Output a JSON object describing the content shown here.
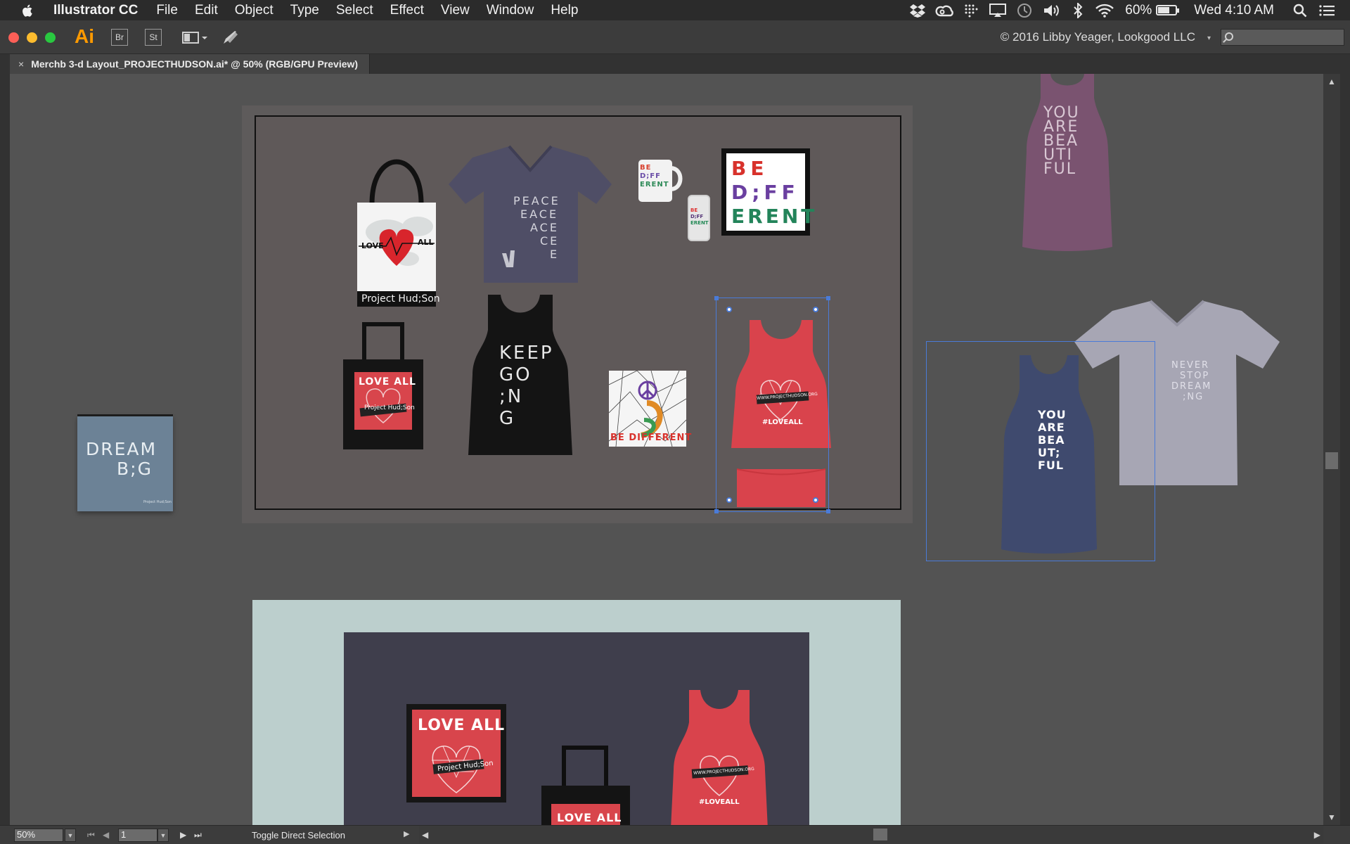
{
  "menubar": {
    "app_name": "Illustrator CC",
    "items": [
      "File",
      "Edit",
      "Object",
      "Type",
      "Select",
      "Effect",
      "View",
      "Window",
      "Help"
    ],
    "battery_percent": "60%",
    "battery_level": 0.6,
    "clock": "Wed 4:10 AM",
    "icons": [
      "dropbox-icon",
      "creative-cloud-icon",
      "grid-icon",
      "airplay-icon",
      "time-machine-icon",
      "volume-icon",
      "bluetooth-icon",
      "wifi-icon",
      "spotlight-icon",
      "notification-center-icon"
    ]
  },
  "toolbar": {
    "ai_label": "Ai",
    "bridge_label": "Br",
    "stock_label": "St",
    "workspace_owner": "© 2016 Libby Yeager, Lookgood LLC",
    "search_placeholder": ""
  },
  "document": {
    "tab_title": "Merchb 3-d Layout_PROJECTHUDSON.ai* @ 50% (RGB/GPU Preview)",
    "close_glyph": "×"
  },
  "artwork": {
    "tote_love": "LOVE",
    "tote_all": "ALL",
    "tote_brand": "Project Hud;Son",
    "tee_peace_lines": [
      "PEACE",
      "EACE",
      "ACE",
      "CE",
      "E"
    ],
    "be_different_poster": [
      "BE",
      "D;FF",
      "ERENT"
    ],
    "mug_text": [
      "BE",
      "D;FF",
      "ERENT"
    ],
    "phone_text": [
      "BE",
      "D;FF",
      "ERENT"
    ],
    "black_tote_love_all": "LOVE ALL",
    "black_tote_brand": "Project Hud;Son",
    "keep_going_lines": [
      "KEEP",
      "GO",
      ";N",
      "G"
    ],
    "be_different_card": "BE DIFFERENT",
    "red_tank_url": "WWW.PROJECTHUDSON.ORG",
    "red_tank_tag": "#LOVEALL",
    "dream_big_lines": [
      "DREAM",
      "B;G"
    ],
    "dream_big_small": "Project Hud;Son",
    "maroon_tank_lines": [
      "YOU",
      "ARE",
      "BEA",
      "UTI",
      "FUL"
    ],
    "navy_tank_lines": [
      "YOU",
      "ARE",
      "BEA",
      "UT;",
      "FUL"
    ],
    "grey_tee_lines": [
      "NEVER",
      "STOP",
      "DREAM",
      ";NG"
    ],
    "ab2_poster_love_all": "LOVE ALL",
    "ab2_poster_brand": "Project Hud;Son",
    "ab2_tote_love_all": "LOVE ALL",
    "ab2_tank_url": "WWW.PROJECTHUDSON.ORG",
    "ab2_tank_tag": "#LOVEALL"
  },
  "statusbar": {
    "zoom": "50%",
    "page": "1",
    "status_text": "Toggle Direct Selection"
  },
  "colors": {
    "accent_selection": "#4a7bd8",
    "red_merch": "#d9434c",
    "ai_orange": "#ff9a00"
  }
}
